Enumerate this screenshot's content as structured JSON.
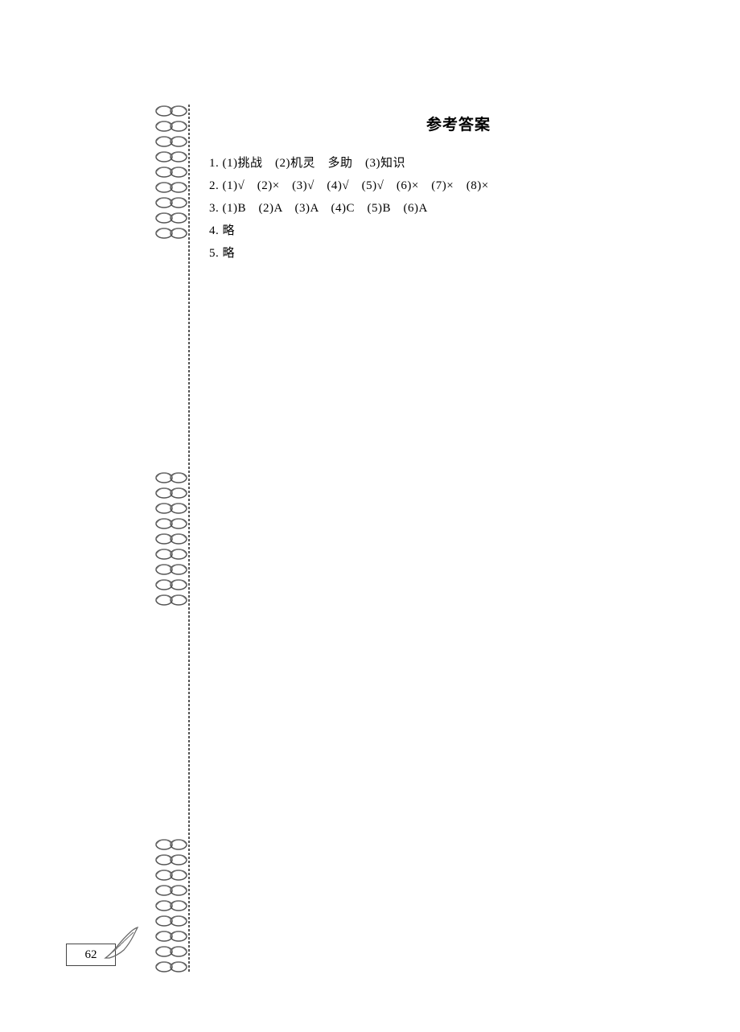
{
  "title": "参考答案",
  "answers": {
    "line1": "1. (1)挑战　(2)机灵　多助　(3)知识",
    "line2": "2. (1)√　(2)×　(3)√　(4)√　(5)√　(6)×　(7)×　(8)×",
    "line3": "3. (1)B　(2)A　(3)A　(4)C　(5)B　(6)A",
    "line4": "4. 略",
    "line5": "5. 略"
  },
  "pageNumber": "62"
}
